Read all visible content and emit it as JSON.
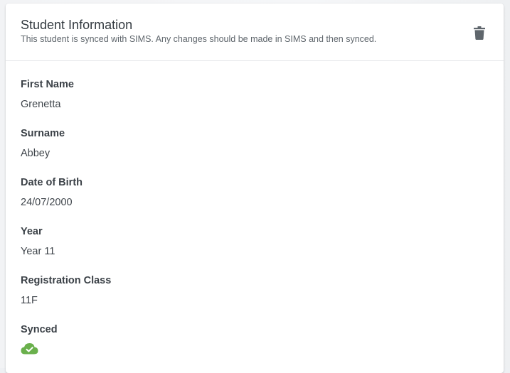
{
  "card": {
    "title": "Student Information",
    "subtitle": "This student is synced with SIMS. Any changes should be made in SIMS and then synced.",
    "delete_icon": "trash-icon"
  },
  "fields": {
    "first_name": {
      "label": "First Name",
      "value": "Grenetta"
    },
    "surname": {
      "label": "Surname",
      "value": "Abbey"
    },
    "date_of_birth": {
      "label": "Date of Birth",
      "value": "24/07/2000"
    },
    "year": {
      "label": "Year",
      "value": "Year 11"
    },
    "registration_class": {
      "label": "Registration Class",
      "value": "11F"
    },
    "synced": {
      "label": "Synced",
      "icon": "cloud-check-icon",
      "status": true
    }
  },
  "colors": {
    "synced_green": "#6ab04c",
    "icon_grey": "#5f666c"
  }
}
